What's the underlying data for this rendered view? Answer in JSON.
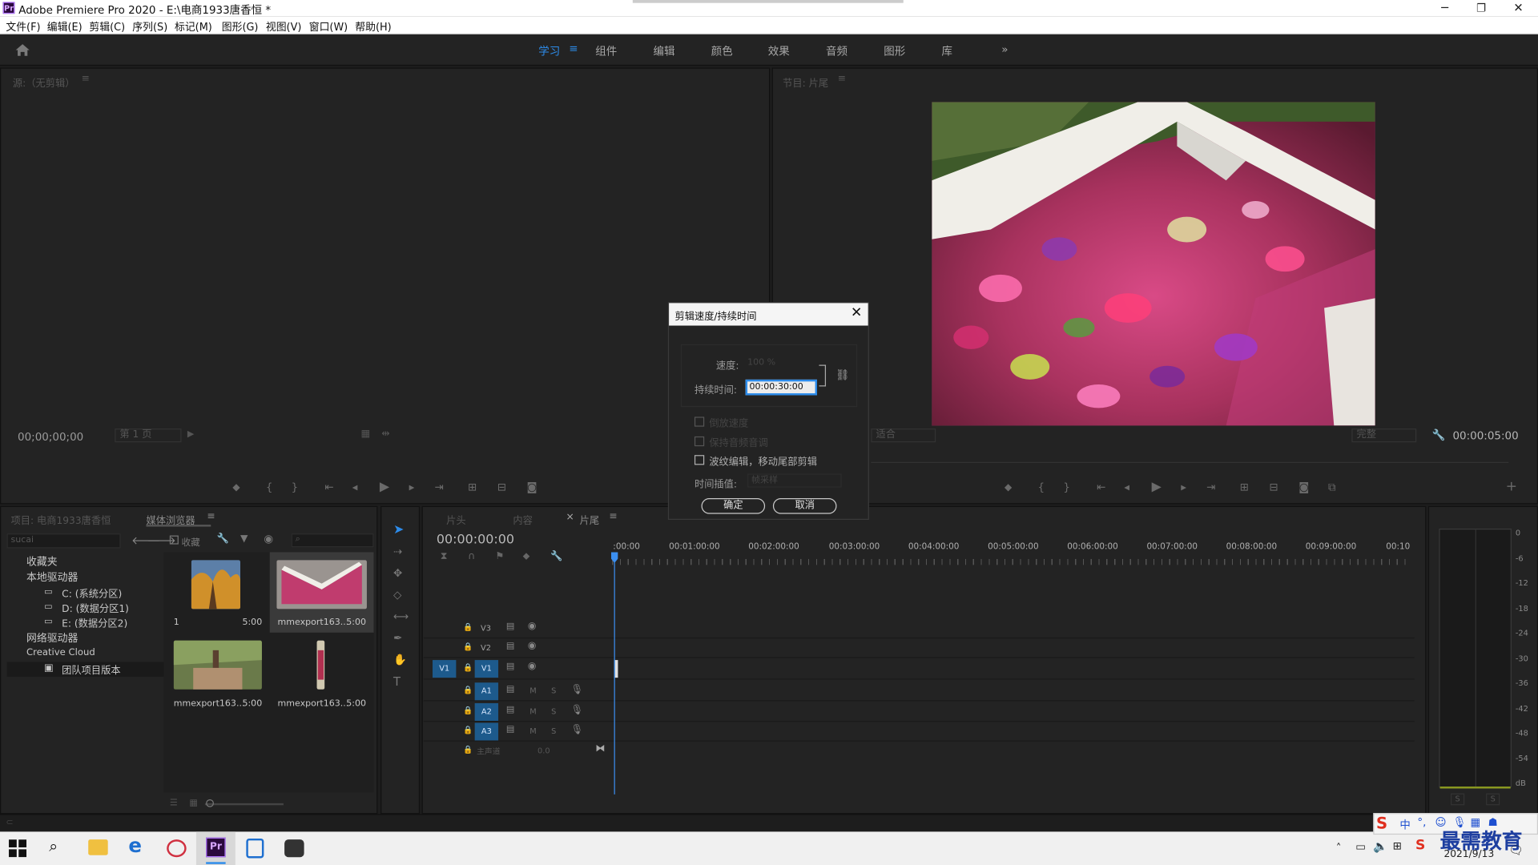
{
  "window": {
    "title": "Adobe Premiere Pro 2020 - E:\\电商1933唐香恒 *",
    "app_icon": "Pr"
  },
  "menu": [
    "文件(F)",
    "编辑(E)",
    "剪辑(C)",
    "序列(S)",
    "标记(M)",
    "图形(G)",
    "视图(V)",
    "窗口(W)",
    "帮助(H)"
  ],
  "workspaces": [
    "学习",
    "组件",
    "编辑",
    "颜色",
    "效果",
    "音频",
    "图形",
    "库"
  ],
  "workspace_active": "学习",
  "source_monitor": {
    "title": "源:（无剪辑）",
    "timecode": "00;00;00;00",
    "page": "第 1 页"
  },
  "program_monitor": {
    "title": "节目: 片尾",
    "fit": "适合",
    "quality": "完整",
    "timecode": "00:00:05:00"
  },
  "project_panel": {
    "tabs": [
      "项目: 电商1933唐香恒",
      "媒体浏览器"
    ],
    "search_value": "sucai",
    "favorites_label": "收藏",
    "tree": [
      {
        "label": "收藏夹",
        "level": 0
      },
      {
        "label": "本地驱动器",
        "level": 0
      },
      {
        "label": "C: (系统分区)",
        "level": 1
      },
      {
        "label": "D: (数据分区1)",
        "level": 1
      },
      {
        "label": "E: (数据分区2)",
        "level": 1
      },
      {
        "label": "网络驱动器",
        "level": 0
      },
      {
        "label": "Creative Cloud",
        "level": 0
      },
      {
        "label": "团队项目版本",
        "level": 1
      }
    ],
    "clips": [
      {
        "name": "1",
        "duration": "5:00"
      },
      {
        "name": "mmexport163...",
        "duration": "5:00"
      },
      {
        "name": "mmexport163...",
        "duration": "5:00"
      },
      {
        "name": "mmexport163...",
        "duration": "5:00"
      }
    ]
  },
  "timeline": {
    "tabs": [
      "片头",
      "内容",
      "片尾"
    ],
    "active_tab": "片尾",
    "timecode": "00:00:00:00",
    "ruler": [
      ":00:00",
      "00:01:00:00",
      "00:02:00:00",
      "00:03:00:00",
      "00:04:00:00",
      "00:05:00:00",
      "00:06:00:00",
      "00:07:00:00",
      "00:08:00:00",
      "00:09:00:00",
      "00:10"
    ],
    "video_tracks": [
      "V3",
      "V2",
      "V1"
    ],
    "audio_tracks": [
      "A1",
      "A2",
      "A3"
    ],
    "source_patch_video": "V1",
    "master_label": "主声道",
    "master_value": "0.0",
    "track_flags": {
      "mute": "M",
      "solo": "S"
    }
  },
  "audio_meter": {
    "scale": [
      "0",
      "-6",
      "-12",
      "-18",
      "-24",
      "-30",
      "-36",
      "-42",
      "-48",
      "-54",
      "dB"
    ],
    "solo_buttons": [
      "S",
      "S"
    ]
  },
  "dialog": {
    "title": "剪辑速度/持续时间",
    "speed_label": "速度:",
    "speed_value": "100 %",
    "duration_label": "持续时间:",
    "duration_value": "00:00:30:00",
    "reverse_label": "倒放速度",
    "reverse_checked": false,
    "maintain_pitch_label": "保持音频音调",
    "maintain_pitch_checked": false,
    "ripple_label": "波纹编辑，移动尾部剪辑",
    "ripple_checked": false,
    "interp_label": "时间插值:",
    "interp_value": "帧采样",
    "ok_label": "确定",
    "cancel_label": "取消"
  },
  "taskbar": {
    "date": "2021/9/13",
    "ime": "中",
    "watermark": "最需教育"
  },
  "colors": {
    "accent": "#2d8ceb",
    "panel": "#232323",
    "track_button": "#1d5a8c",
    "playhead": "#3b8ff0"
  }
}
